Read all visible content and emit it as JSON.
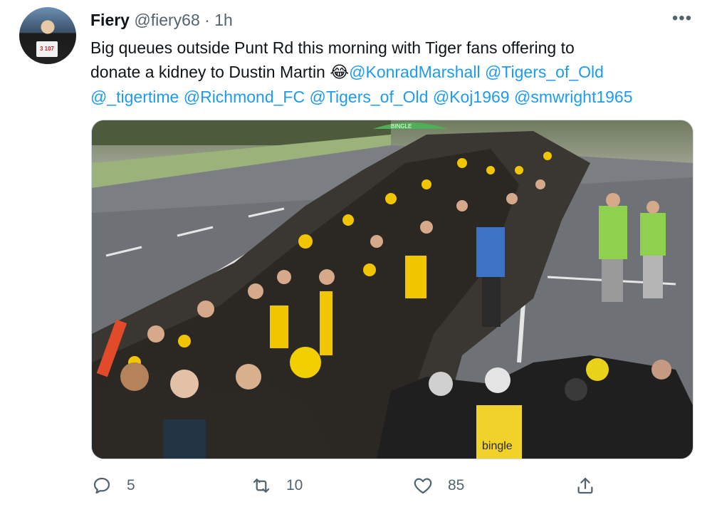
{
  "tweet": {
    "author_name": "Fiery",
    "handle": "@fiery68",
    "separator": "·",
    "time": "1h",
    "more_icon": "more-horizontal-icon",
    "text_line1": "Big queues outside Punt Rd this morning with Tiger fans offering to",
    "text_line2_plain": "donate a kidney to Dustin Martin ",
    "emoji": "😂",
    "mentions": [
      "@KonradMarshall",
      "@Tigers_of_Old",
      "@_tigertime",
      "@Richmond_FC",
      "@Tigers_of_Old",
      "@Koj1969",
      "@smwright1965"
    ],
    "mention_color": "#1d9bf0"
  },
  "avatar": {
    "bib_text": "3 107"
  },
  "media": {
    "alt": "Photo of long queue of Richmond Tigers fans in yellow and black outside Punt Rd",
    "umbrella_text": "BINGLE",
    "vest_text": "bingle"
  },
  "actions": {
    "reply": {
      "icon": "reply-icon",
      "count": "5"
    },
    "retweet": {
      "icon": "retweet-icon",
      "count": "10"
    },
    "like": {
      "icon": "heart-icon",
      "count": "85"
    },
    "share": {
      "icon": "share-icon"
    }
  }
}
